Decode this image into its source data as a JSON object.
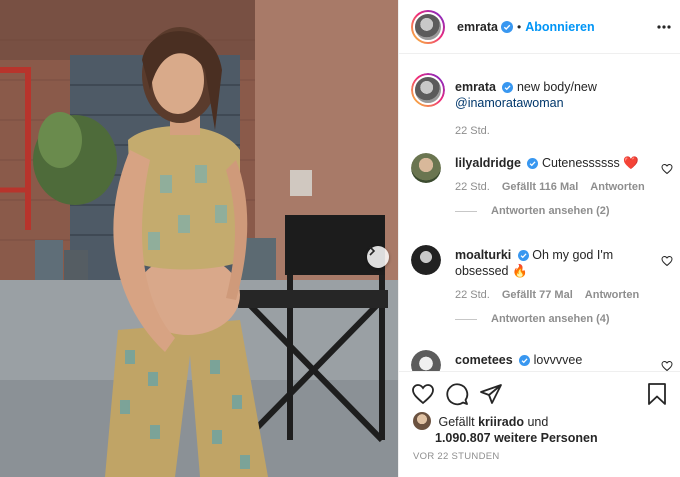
{
  "post": {
    "author": "emrata",
    "follow_label": "Abonnieren",
    "separator": "•"
  },
  "caption": {
    "username": "emrata",
    "text": "new body/new",
    "mention": "@inamoratawoman",
    "time": "22 Std."
  },
  "comments": [
    {
      "username": "lilyaldridge",
      "text": "Cutenessssss",
      "emoji": "❤️",
      "time": "22 Std.",
      "likes": "Gefällt 116 Mal",
      "reply_label": "Antworten",
      "view_replies": "Antworten ansehen (2)"
    },
    {
      "username": "moalturki",
      "text": "Oh my god I'm obsessed",
      "emoji": "🔥",
      "time": "22 Std.",
      "likes": "Gefällt 77 Mal",
      "reply_label": "Antworten",
      "view_replies": "Antworten ansehen (4)"
    },
    {
      "username": "cometees",
      "text": "lovvvvee"
    }
  ],
  "likes": {
    "prefix": "Gefällt",
    "user": "kriirado",
    "conj": "und",
    "others": "1.090.807 weitere Personen"
  },
  "posted_ago": "VOR 22 STUNDEN",
  "icons": {
    "verified": "verified-badge-icon",
    "more": "more-options-icon",
    "like": "heart-icon",
    "comment": "comment-icon",
    "share": "share-icon",
    "save": "bookmark-icon",
    "next": "chevron-right-icon"
  },
  "colors": {
    "accent": "#0095f6",
    "verified": "#3897f0",
    "meta_text": "#8e8e8e",
    "mention": "#00376b",
    "heart_emoji": "#ed4956"
  }
}
